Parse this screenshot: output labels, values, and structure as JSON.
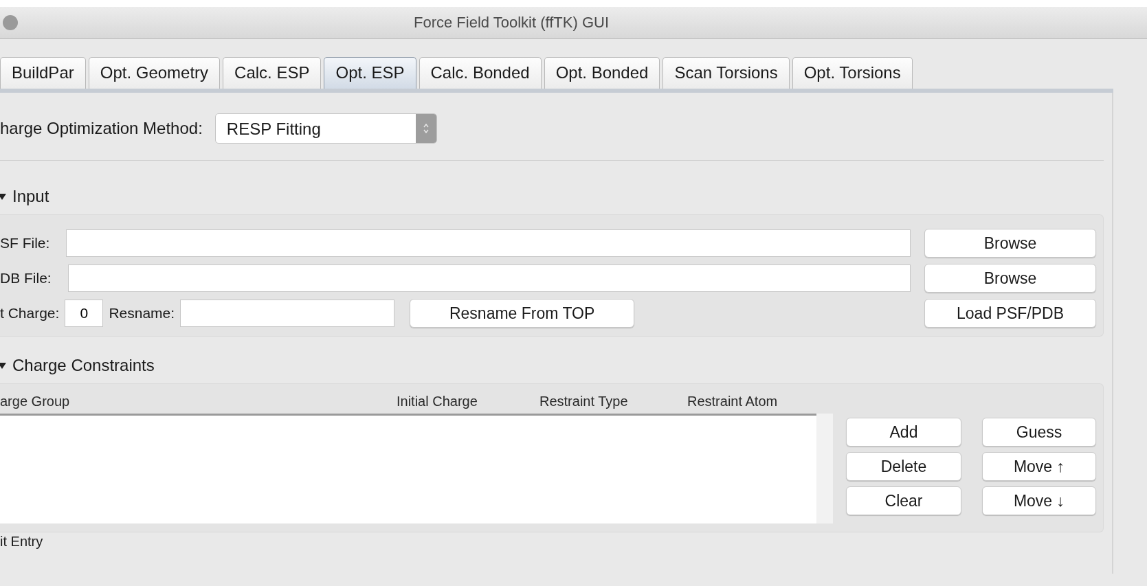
{
  "window": {
    "title": "Force Field Toolkit (ffTK) GUI"
  },
  "tabs": [
    {
      "label": "BuildPar",
      "selected": false
    },
    {
      "label": "Opt. Geometry",
      "selected": false
    },
    {
      "label": "Calc. ESP",
      "selected": false
    },
    {
      "label": "Opt. ESP",
      "selected": true
    },
    {
      "label": "Calc. Bonded",
      "selected": false
    },
    {
      "label": "Opt. Bonded",
      "selected": false
    },
    {
      "label": "Scan Torsions",
      "selected": false
    },
    {
      "label": "Opt. Torsions",
      "selected": false
    }
  ],
  "charge_method": {
    "label": "harge Optimization Method:",
    "value": "RESP Fitting"
  },
  "input_section": {
    "title": "Input",
    "expanded": true,
    "file_rows": [
      {
        "label": "SF File:",
        "button": "Browse"
      },
      {
        "label": "DB File:",
        "button": "Browse"
      }
    ],
    "net_charge": {
      "label": "t Charge:",
      "value": "0"
    },
    "resname": {
      "label": "Resname:"
    },
    "resname_button": "Resname From TOP",
    "load_button": "Load PSF/PDB"
  },
  "constraints": {
    "title": "Charge Constraints",
    "expanded": true,
    "columns": [
      "arge Group",
      "Initial Charge",
      "Restraint Type",
      "Restraint Atom"
    ],
    "buttons": [
      "Add",
      "Guess",
      "Delete",
      "Move ↑",
      "Clear",
      "Move ↓"
    ]
  },
  "footer_label": "it Entry"
}
